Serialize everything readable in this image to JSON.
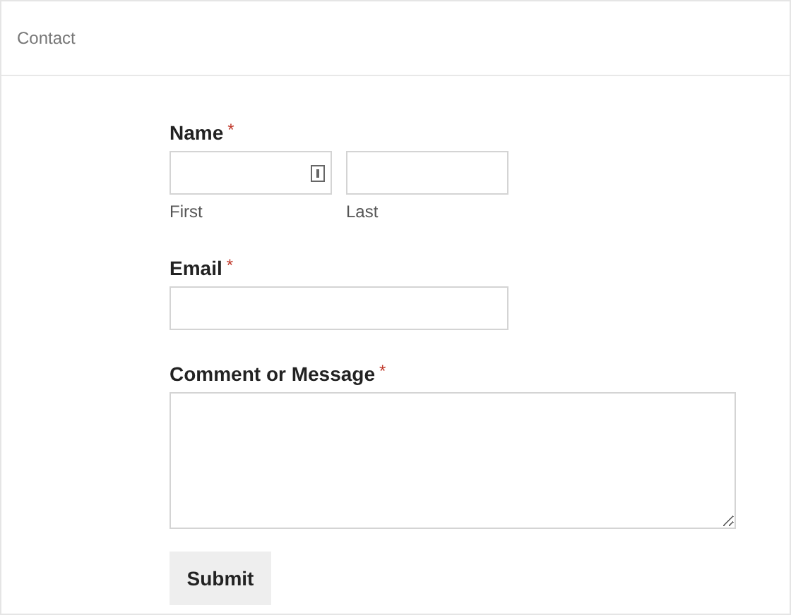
{
  "title": "Contact",
  "fields": [
    {
      "kind": "name",
      "label": "Name",
      "required_mark": "*",
      "parts": [
        {
          "sublabel": "First",
          "autofill_icon": true
        },
        {
          "sublabel": "Last",
          "autofill_icon": false
        }
      ]
    },
    {
      "kind": "input",
      "label": "Email",
      "required_mark": "*"
    },
    {
      "kind": "textarea",
      "label": "Comment or Message",
      "required_mark": "*"
    }
  ],
  "submit": "Submit"
}
